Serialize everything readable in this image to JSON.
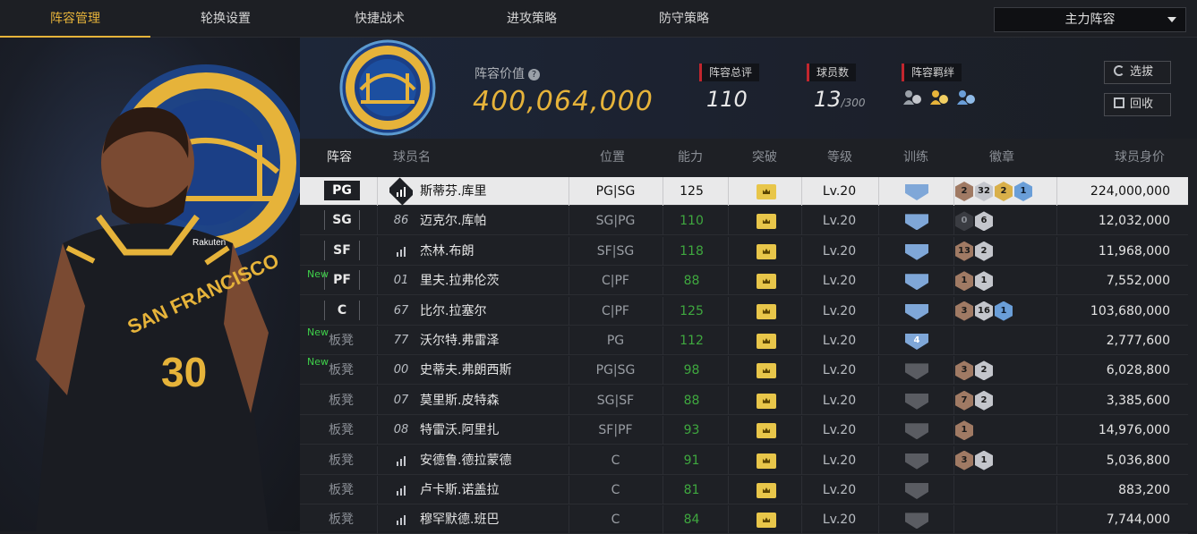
{
  "tabs": [
    "阵容管理",
    "轮换设置",
    "快捷战术",
    "进攻策略",
    "防守策略"
  ],
  "lineup_select": "主力阵容",
  "header": {
    "value_label": "阵容价值",
    "value": "400,064,000",
    "overall_label": "阵容总评",
    "overall": "110",
    "players_label": "球员数",
    "players_count": "13",
    "players_max": "/300",
    "bond_label": "阵容羁绊",
    "btn_scout": "选拔",
    "btn_recall": "回收"
  },
  "columns": {
    "lineup": "阵容",
    "name": "球员名",
    "pos": "位置",
    "ability": "能力",
    "breakthrough": "突破",
    "level": "等级",
    "training": "训练",
    "badges": "徽章",
    "price": "球员身价"
  },
  "rows": [
    {
      "slot": "PG",
      "new": "",
      "jersey": "",
      "name": "斯蒂芬.库里",
      "pos": "PG|SG",
      "ability": "125",
      "level": "Lv.20",
      "train": "",
      "train_color": "blue",
      "badges": [
        [
          "2",
          "bronze"
        ],
        [
          "32",
          "silver"
        ],
        [
          "2",
          "gold"
        ],
        [
          "1",
          "blue"
        ]
      ],
      "price": "224,000,000"
    },
    {
      "slot": "SG",
      "new": "",
      "jersey": "86",
      "name": "迈克尔.库帕",
      "pos": "SG|PG",
      "ability": "110",
      "level": "Lv.20",
      "train": "",
      "train_color": "blue",
      "badges": [
        [
          "0",
          "dark"
        ],
        [
          "6",
          "silver"
        ]
      ],
      "price": "12,032,000"
    },
    {
      "slot": "SF",
      "new": "",
      "jersey": "",
      "name": "杰林.布朗",
      "pos": "SF|SG",
      "ability": "118",
      "level": "Lv.20",
      "train": "",
      "train_color": "blue",
      "badges": [
        [
          "13",
          "bronze"
        ],
        [
          "2",
          "silver"
        ]
      ],
      "price": "11,968,000"
    },
    {
      "slot": "PF",
      "new": "New",
      "jersey": "01",
      "name": "里夫.拉弗伦茨",
      "pos": "C|PF",
      "ability": "88",
      "level": "Lv.20",
      "train": "",
      "train_color": "blue",
      "badges": [
        [
          "1",
          "bronze"
        ],
        [
          "1",
          "silver"
        ]
      ],
      "price": "7,552,000"
    },
    {
      "slot": "C",
      "new": "",
      "jersey": "67",
      "name": "比尔.拉塞尔",
      "pos": "C|PF",
      "ability": "125",
      "level": "Lv.20",
      "train": "",
      "train_color": "blue",
      "badges": [
        [
          "3",
          "bronze"
        ],
        [
          "16",
          "silver"
        ],
        [
          "1",
          "blue"
        ]
      ],
      "price": "103,680,000"
    },
    {
      "slot": "板凳",
      "new": "New",
      "jersey": "77",
      "name": "沃尔特.弗雷泽",
      "pos": "PG",
      "ability": "112",
      "level": "Lv.20",
      "train": "4",
      "train_color": "blue",
      "badges": [],
      "price": "2,777,600"
    },
    {
      "slot": "板凳",
      "new": "New",
      "jersey": "00",
      "name": "史蒂夫.弗朗西斯",
      "pos": "PG|SG",
      "ability": "98",
      "level": "Lv.20",
      "train": "",
      "train_color": "gray",
      "badges": [
        [
          "3",
          "bronze"
        ],
        [
          "2",
          "silver"
        ]
      ],
      "price": "6,028,800"
    },
    {
      "slot": "板凳",
      "new": "",
      "jersey": "07",
      "name": "莫里斯.皮特森",
      "pos": "SG|SF",
      "ability": "88",
      "level": "Lv.20",
      "train": "",
      "train_color": "gray",
      "badges": [
        [
          "7",
          "bronze"
        ],
        [
          "2",
          "silver"
        ]
      ],
      "price": "3,385,600"
    },
    {
      "slot": "板凳",
      "new": "",
      "jersey": "08",
      "name": "特雷沃.阿里扎",
      "pos": "SF|PF",
      "ability": "93",
      "level": "Lv.20",
      "train": "",
      "train_color": "gray",
      "badges": [
        [
          "1",
          "bronze"
        ]
      ],
      "price": "14,976,000"
    },
    {
      "slot": "板凳",
      "new": "",
      "jersey": "",
      "name": "安德鲁.德拉蒙德",
      "pos": "C",
      "ability": "91",
      "level": "Lv.20",
      "train": "",
      "train_color": "gray",
      "badges": [
        [
          "3",
          "bronze"
        ],
        [
          "1",
          "silver"
        ]
      ],
      "price": "5,036,800"
    },
    {
      "slot": "板凳",
      "new": "",
      "jersey": "",
      "name": "卢卡斯.诺盖拉",
      "pos": "C",
      "ability": "81",
      "level": "Lv.20",
      "train": "",
      "train_color": "gray",
      "badges": [],
      "price": "883,200"
    },
    {
      "slot": "板凳",
      "new": "",
      "jersey": "",
      "name": "穆罕默德.班巴",
      "pos": "C",
      "ability": "84",
      "level": "Lv.20",
      "train": "",
      "train_color": "gray",
      "badges": [],
      "price": "7,744,000"
    }
  ],
  "player_art": {
    "team_text": "SAN FRANCISCO",
    "number": "30",
    "sponsor": "Rakuten"
  }
}
